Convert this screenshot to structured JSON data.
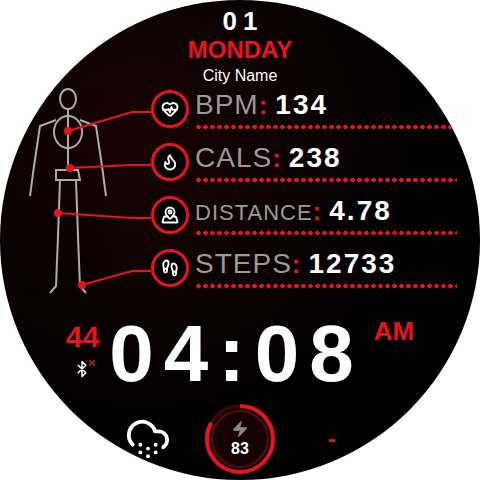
{
  "header": {
    "day": "01",
    "weekday": "MONDAY",
    "city": "City Name"
  },
  "stats": [
    {
      "label": "BPM",
      "separator": ":",
      "value": "134"
    },
    {
      "label": "CALS",
      "separator": ":",
      "value": "238"
    },
    {
      "label": "DISTANCE",
      "separator": ":",
      "value": "4.78"
    },
    {
      "label": "STEPS",
      "separator": ":",
      "value": "12733"
    }
  ],
  "time": {
    "seconds": "44",
    "clock": "04:08",
    "ampm": "AM"
  },
  "bluetooth": {
    "connected": false
  },
  "weather": {
    "temperature": "-"
  },
  "battery": {
    "reading": "83",
    "level": 0.83
  }
}
